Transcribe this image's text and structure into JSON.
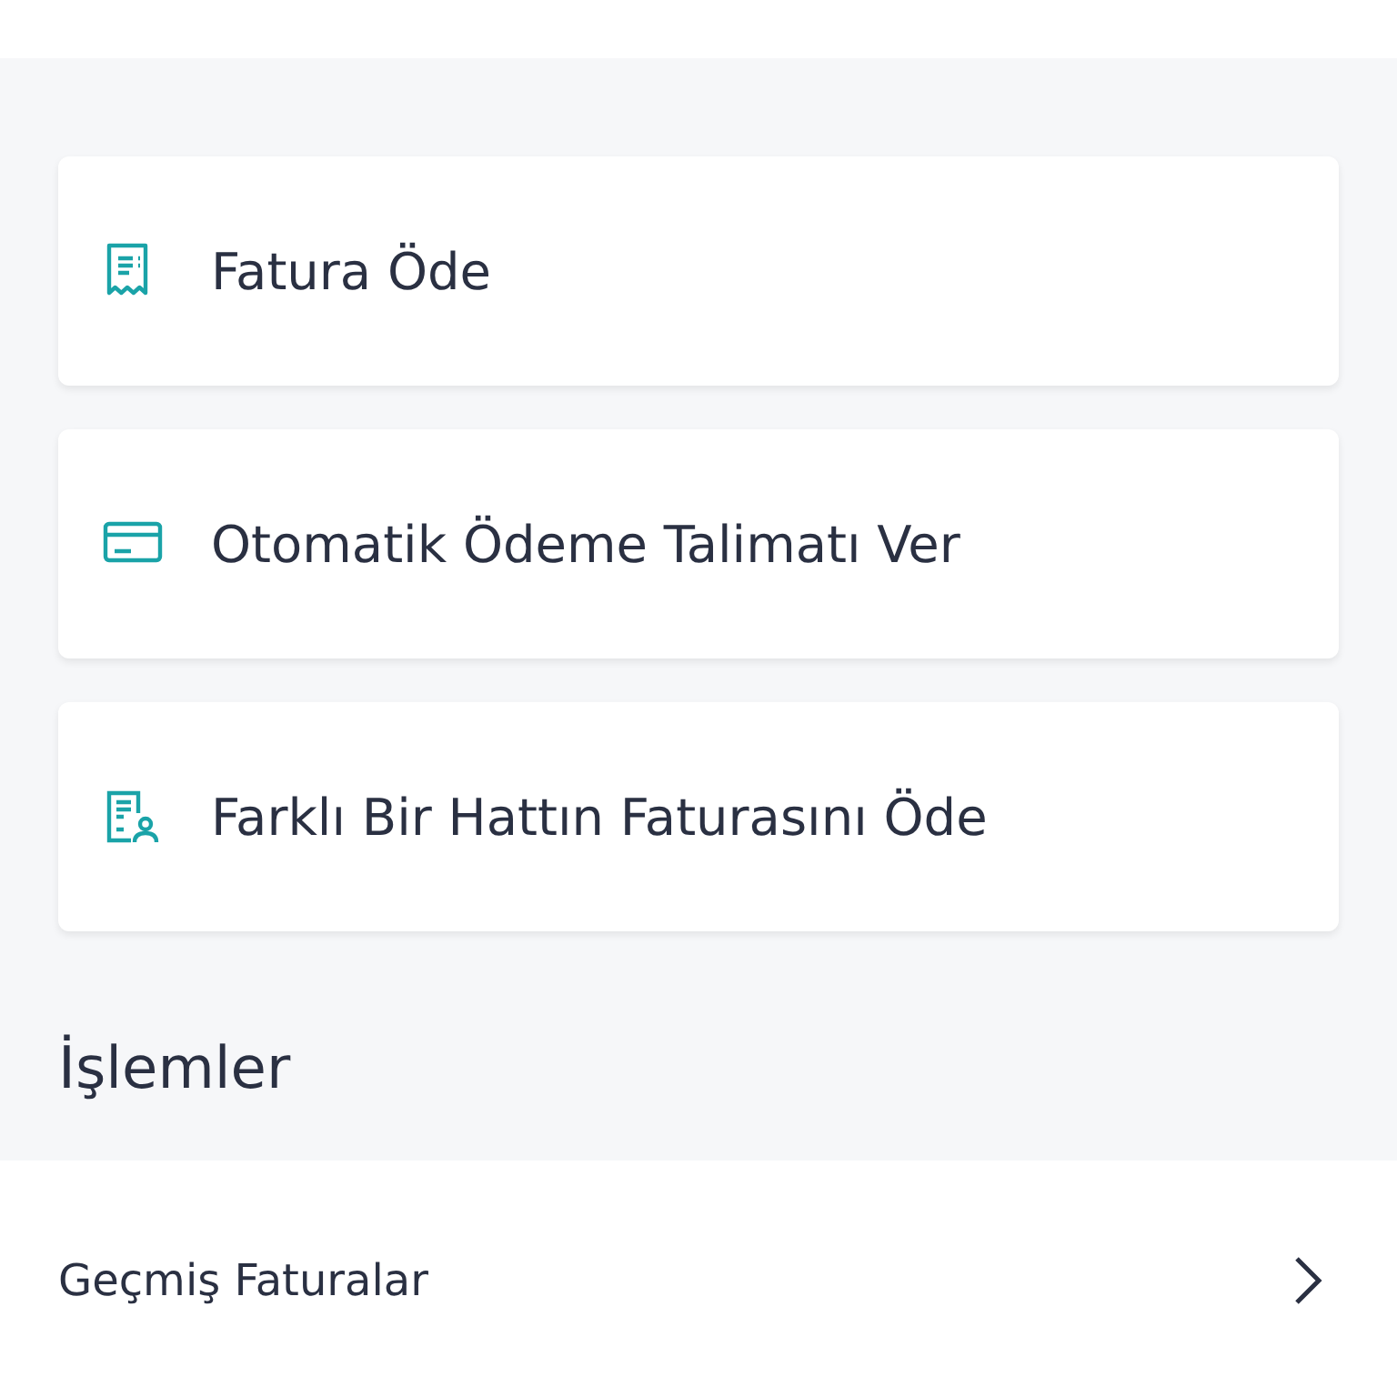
{
  "actions": [
    {
      "kind": "receipt",
      "label": "Fatura Öde"
    },
    {
      "kind": "card",
      "label": "Otomatik Ödeme Talimatı Ver"
    },
    {
      "kind": "person-doc",
      "label": "Farklı Bir Hattın Faturasını Öde"
    }
  ],
  "section_title": "İşlemler",
  "list_items": [
    {
      "label": "Geçmiş Faturalar"
    }
  ]
}
